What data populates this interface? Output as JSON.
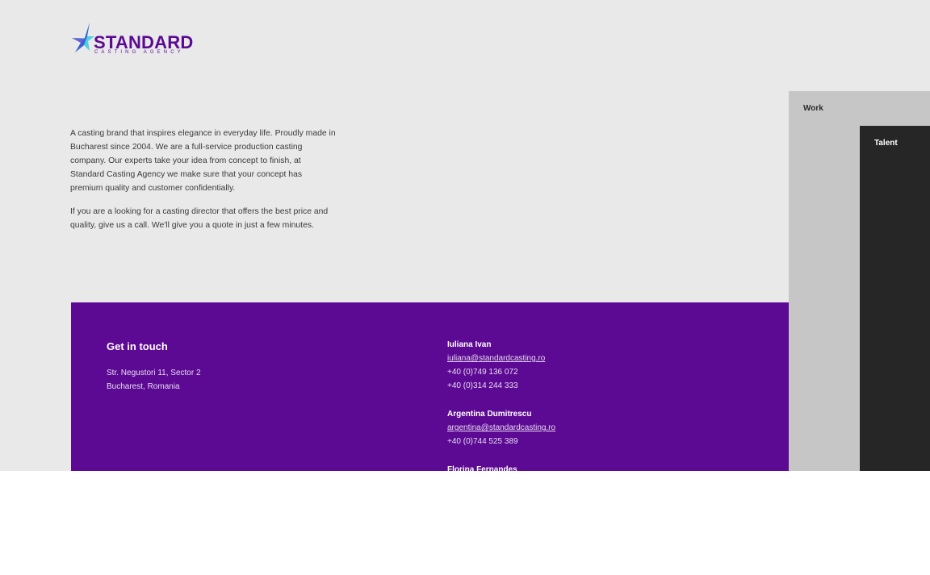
{
  "brand": {
    "name": "STANDARD",
    "tagline": "CASTING AGENCY",
    "colors": {
      "primary": "#5c0a93",
      "star_light": "#4fd0e0",
      "star_dark": "#3a4bd0"
    }
  },
  "intro": {
    "paragraphs": [
      "A casting brand that inspires elegance in everyday life. Proudly made in Bucharest since 2004. We are a full-service production casting company. Our experts take your idea from concept to finish, at Standard Casting Agency we make sure that your concept has premium quality and customer confidentially.",
      "If you are a looking for a casting director that offers the best price and quality, give us a call. We'll give you a quote in just a few minutes."
    ]
  },
  "nav": {
    "work_label": "Work",
    "talent_label": "Talent"
  },
  "contact": {
    "title": "Get in touch",
    "address_line1": "Str. Negustori 11, Sector 2",
    "address_line2": "Bucharest, Romania",
    "people": [
      {
        "name": "Iuliana Ivan",
        "email": "iuliana@standardcasting.ro",
        "phones": [
          "+40 (0)749 136 072",
          "+40 (0)314 244 333"
        ]
      },
      {
        "name": "Argentina Dumitrescu",
        "email": "argentina@standardcasting.ro",
        "phones": [
          "+40 (0)744 525 389"
        ]
      },
      {
        "name": "Florina Fernandes"
      }
    ]
  }
}
